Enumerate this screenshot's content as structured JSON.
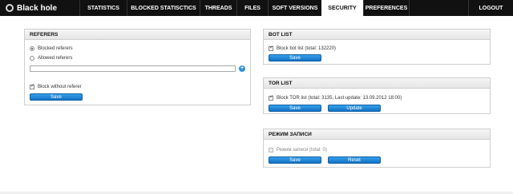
{
  "brand": {
    "name": "Black hole",
    "logo_icon": "circle-logo-icon"
  },
  "nav": {
    "items": [
      {
        "label": "STATISTICS",
        "active": false
      },
      {
        "label": "BLOCKED STATISCTICS",
        "active": false
      },
      {
        "label": "THREADS",
        "active": false
      },
      {
        "label": "FILES",
        "active": false
      },
      {
        "label": "SOFT VERSIONS",
        "active": false
      },
      {
        "label": "SECURITY",
        "active": true
      },
      {
        "label": "PREFERENCES",
        "active": false
      }
    ],
    "logout_label": "LOGOUT"
  },
  "referers": {
    "title": "REFERERS",
    "option_blocked": "Blocked referers",
    "option_allowed": "Allowed referers",
    "selected": "Blocked referers",
    "input_value": "",
    "add_icon": "plus-icon",
    "block_without_referer_label": "Block without referer",
    "block_without_referer_checked": true,
    "save_label": "Save"
  },
  "bot_list": {
    "title": "BOT LIST",
    "checkbox_label": "Block bot list (total: 132220)",
    "checked": true,
    "save_label": "Save"
  },
  "tor_list": {
    "title": "TOR LIST",
    "checkbox_label": "Block TOR list (total: 3135, Last update: 13.09.2012 18:00)",
    "checked": true,
    "save_label": "Save",
    "update_label": "Update"
  },
  "record_mode": {
    "title": "РЕЖИМ ЗАПИСИ",
    "checkbox_label": "Режим записи (total: 0)",
    "checked": false,
    "save_label": "Save",
    "reset_label": "Reset"
  },
  "colors": {
    "topbar": "#111111",
    "button": "#1f86d6",
    "accent": "#2f8fd9"
  }
}
